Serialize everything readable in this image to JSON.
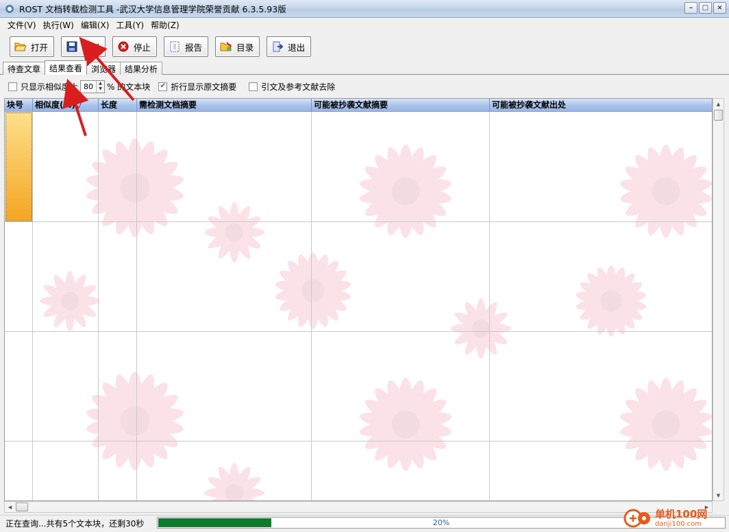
{
  "window": {
    "title": "ROST 文档转载检测工具 -武汉大学信息管理学院荣誉贡献 6.3.5.93版"
  },
  "menu": [
    "文件(V)",
    "执行(W)",
    "编辑(X)",
    "工具(Y)",
    "帮助(Z)"
  ],
  "toolbar": {
    "open": "打开",
    "detect": "检测",
    "stop": "停止",
    "report": "报告",
    "catalog": "目录",
    "exit": "退出"
  },
  "tabs": [
    "待查文章",
    "结果查看",
    "浏览器",
    "结果分析"
  ],
  "active_tab": "结果查看",
  "options": {
    "only_show_label_pre": "只显示相似度大",
    "threshold": "80",
    "only_show_label_post": "% 的文本块",
    "only_show_checked": false,
    "wrap_label": "折行显示原文摘要",
    "wrap_checked": true,
    "remove_refs_label": "引文及参考文献去除",
    "remove_refs_checked": false
  },
  "grid": {
    "columns": [
      "块号",
      "相似度(%)▽",
      "长度",
      "需检测文档摘要",
      "可能被抄袭文献摘要",
      "可能被抄袭文献出处"
    ]
  },
  "status": {
    "text": "正在查询...共有5个文本块，还剩30秒",
    "progress": 0.2,
    "progress_label": "20%"
  },
  "watermark": {
    "cn": "单机100网",
    "url": "danji100.com"
  },
  "colors": {
    "header_blue": "#a9c2ea",
    "progress_green": "#0f7a2e",
    "annotation_red": "#d81e1e",
    "indicator_orange": "#f4a524"
  }
}
